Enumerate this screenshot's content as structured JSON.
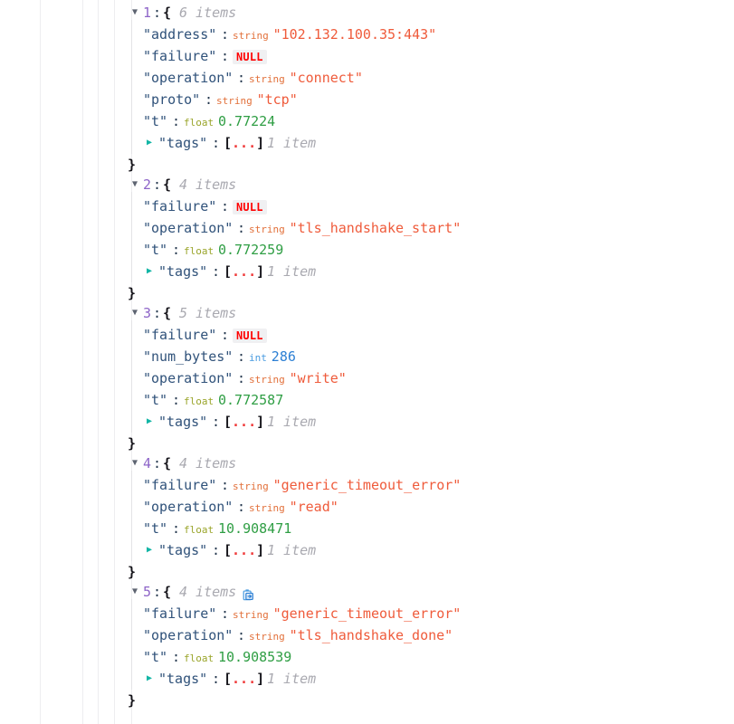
{
  "viewer": {
    "kind": "json-tree-viewer",
    "indent_guides_x": [
      44,
      91,
      108,
      126,
      145
    ],
    "colors": {
      "index": "#8d64c8",
      "key": "#30527a",
      "string_value": "#ef5b3b",
      "float_value": "#2f9e44",
      "int_value": "#2b7fd4",
      "null_value": "#ff0000",
      "type_label_string": "#e2703a",
      "type_label_float": "#9aa52a",
      "type_label_int": "#4a9ce0",
      "muted": "#a9a9b0",
      "guide_line": "#ededf0"
    },
    "glyphs": {
      "open_twisty": "▼",
      "closed_twisty": "▶",
      "open_brace": "{",
      "close_brace": "}",
      "collapsed_array": "[...]",
      "colon": ":",
      "quote": "\""
    }
  },
  "nodes": [
    {
      "index": "1",
      "twisty": "▼",
      "open_brace": "{",
      "count": "6 items",
      "has_copy_icon": false,
      "copy_icon": "",
      "close_brace": "}",
      "rows": [
        {
          "key": "\"address\"",
          "colon": ":",
          "type": "string",
          "type_label": "string",
          "value": "\"102.132.100.35:443\""
        },
        {
          "key": "\"failure\"",
          "colon": ":",
          "type": "null",
          "type_label": "",
          "value": "NULL"
        },
        {
          "key": "\"operation\"",
          "colon": ":",
          "type": "string",
          "type_label": "string",
          "value": "\"connect\""
        },
        {
          "key": "\"proto\"",
          "colon": ":",
          "type": "string",
          "type_label": "string",
          "value": "\"tcp\""
        },
        {
          "key": "\"t\"",
          "colon": ":",
          "type": "float",
          "type_label": "float",
          "value": "0.77224"
        },
        {
          "key": "\"tags\"",
          "colon": ":",
          "type": "collapsed-array",
          "type_label": "",
          "value": "[...]",
          "count": "1 item",
          "twisty": "▶"
        }
      ]
    },
    {
      "index": "2",
      "twisty": "▼",
      "open_brace": "{",
      "count": "4 items",
      "has_copy_icon": false,
      "copy_icon": "",
      "close_brace": "}",
      "rows": [
        {
          "key": "\"failure\"",
          "colon": ":",
          "type": "null",
          "type_label": "",
          "value": "NULL"
        },
        {
          "key": "\"operation\"",
          "colon": ":",
          "type": "string",
          "type_label": "string",
          "value": "\"tls_handshake_start\""
        },
        {
          "key": "\"t\"",
          "colon": ":",
          "type": "float",
          "type_label": "float",
          "value": "0.772259"
        },
        {
          "key": "\"tags\"",
          "colon": ":",
          "type": "collapsed-array",
          "type_label": "",
          "value": "[...]",
          "count": "1 item",
          "twisty": "▶"
        }
      ]
    },
    {
      "index": "3",
      "twisty": "▼",
      "open_brace": "{",
      "count": "5 items",
      "has_copy_icon": false,
      "copy_icon": "",
      "close_brace": "}",
      "rows": [
        {
          "key": "\"failure\"",
          "colon": ":",
          "type": "null",
          "type_label": "",
          "value": "NULL"
        },
        {
          "key": "\"num_bytes\"",
          "colon": ":",
          "type": "int",
          "type_label": "int",
          "value": "286"
        },
        {
          "key": "\"operation\"",
          "colon": ":",
          "type": "string",
          "type_label": "string",
          "value": "\"write\""
        },
        {
          "key": "\"t\"",
          "colon": ":",
          "type": "float",
          "type_label": "float",
          "value": "0.772587"
        },
        {
          "key": "\"tags\"",
          "colon": ":",
          "type": "collapsed-array",
          "type_label": "",
          "value": "[...]",
          "count": "1 item",
          "twisty": "▶"
        }
      ]
    },
    {
      "index": "4",
      "twisty": "▼",
      "open_brace": "{",
      "count": "4 items",
      "has_copy_icon": false,
      "copy_icon": "",
      "close_brace": "}",
      "rows": [
        {
          "key": "\"failure\"",
          "colon": ":",
          "type": "string",
          "type_label": "string",
          "value": "\"generic_timeout_error\""
        },
        {
          "key": "\"operation\"",
          "colon": ":",
          "type": "string",
          "type_label": "string",
          "value": "\"read\""
        },
        {
          "key": "\"t\"",
          "colon": ":",
          "type": "float",
          "type_label": "float",
          "value": "10.908471"
        },
        {
          "key": "\"tags\"",
          "colon": ":",
          "type": "collapsed-array",
          "type_label": "",
          "value": "[...]",
          "count": "1 item",
          "twisty": "▶"
        }
      ]
    },
    {
      "index": "5",
      "twisty": "▼",
      "open_brace": "{",
      "count": "4 items",
      "has_copy_icon": true,
      "copy_icon": "copy-to-clipboard-icon",
      "close_brace": "}",
      "rows": [
        {
          "key": "\"failure\"",
          "colon": ":",
          "type": "string",
          "type_label": "string",
          "value": "\"generic_timeout_error\""
        },
        {
          "key": "\"operation\"",
          "colon": ":",
          "type": "string",
          "type_label": "string",
          "value": "\"tls_handshake_done\""
        },
        {
          "key": "\"t\"",
          "colon": ":",
          "type": "float",
          "type_label": "float",
          "value": "10.908539"
        },
        {
          "key": "\"tags\"",
          "colon": ":",
          "type": "collapsed-array",
          "type_label": "",
          "value": "[...]",
          "count": "1 item",
          "twisty": "▶"
        }
      ]
    }
  ]
}
